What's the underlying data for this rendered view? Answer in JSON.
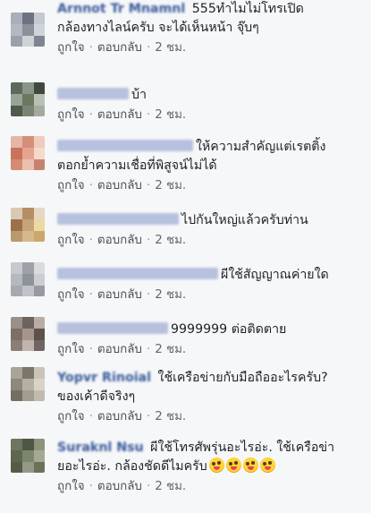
{
  "comments": [
    {
      "name": "Arnnot Tr Mnamnl",
      "lines": [
        "555ทำไมไม่โทรเปิด",
        "กล้องทางไลน์ครับ จะได้เห็นหน้า จุ๊บๆ"
      ],
      "like": "ถูกใจ",
      "reply": "ตอบกลับ",
      "time": "2 ชม.",
      "avatar": [
        "#a9aeb8",
        "#6d7280",
        "#c4c8cf",
        "#b3b8c1",
        "#8b909b",
        "#d0d3d8",
        "#9ba1ab",
        "#cfd2d7",
        "#7e8490"
      ]
    },
    {
      "name": "",
      "lines": [
        "บ้า"
      ],
      "like": "ถูกใจ",
      "reply": "ตอบกลับ",
      "time": "2 ชม.",
      "avatar": [
        "#5b6a5a",
        "#8a9488",
        "#3f4a3e",
        "#9aa398",
        "#6c775f",
        "#b8bfb4",
        "#4d5a4c",
        "#7a8374",
        "#a3ab9f"
      ]
    },
    {
      "name": "",
      "lines": [
        "ให้ความสำคัญแต่เรตติ้ง",
        "ตอกย้ำความเชื่อที่พิสูจน์ไม่ได้"
      ],
      "like": "ถูกใจ",
      "reply": "ตอบกลับ",
      "time": "2 ชม.",
      "avatar": [
        "#e3b7a4",
        "#d38f79",
        "#f0cbbb",
        "#c9735d",
        "#e6a48f",
        "#f4d9cd",
        "#d68a74",
        "#ecc0ae",
        "#c7826d"
      ]
    },
    {
      "name": "",
      "lines": [
        "ไปกันใหญ่แล้วครับท่าน"
      ],
      "like": "ถูกใจ",
      "reply": "ตอบกลับ",
      "time": "2 ชม.",
      "avatar": [
        "#d9c9b3",
        "#b38e66",
        "#e6d8c3",
        "#9c7048",
        "#c7a37a",
        "#edd9a2",
        "#b89a6e",
        "#d6b98a",
        "#caa86a"
      ]
    },
    {
      "name": "",
      "lines": [
        "ผีใช้สัญญาณค่ายใด"
      ],
      "like": "ถูกใจ",
      "reply": "ตอบกลับ",
      "time": "2 ชม.",
      "avatar": [
        "#c7c9cc",
        "#9ea2a8",
        "#d9dbde",
        "#b5b8bd",
        "#8e9299",
        "#cbcdd1",
        "#a6a9af",
        "#c0c3c7",
        "#979ba1"
      ]
    },
    {
      "name": "",
      "lines": [
        "9999999 ต่อติดตาย"
      ],
      "like": "ถูกใจ",
      "reply": "ตอบกลับ",
      "time": "2 ชม.",
      "avatar": [
        "#9a8f89",
        "#6f625c",
        "#b8aca4",
        "#7d6f68",
        "#a6958c",
        "#5d514c",
        "#8c7d76",
        "#c2b4ab",
        "#706560"
      ]
    },
    {
      "name": "Yopvr Rinoial",
      "lines": [
        "ใช้เครือข่ายกับมือถืออะไรครับ?",
        "ของเค้าดีจริงๆ"
      ],
      "like": "ถูกใจ",
      "reply": "ตอบกลับ",
      "time": "2 ชม.",
      "avatar": [
        "#a9a39a",
        "#7c756a",
        "#c9c3b8",
        "#8f887c",
        "#b6afa3",
        "#d8d2c7",
        "#746d62",
        "#a39c90",
        "#c1bbaf"
      ]
    },
    {
      "name": "Suraknl Nsu",
      "lines": [
        "ผีใช้โทรศัพรุ่นอะไรอ่ะ. ใช้เครือข่า",
        "ยอะไรอ่ะ. กล้องชัดดีไมครับ"
      ],
      "emoji_count": 4,
      "like": "ถูกใจ",
      "reply": "ตอบกลับ",
      "time": "2 ชม.",
      "avatar": [
        "#6e7560",
        "#4e5744",
        "#8c937c",
        "#5c6650",
        "#7d856d",
        "#a3a993",
        "#545c48",
        "#939a84",
        "#6a7259"
      ]
    }
  ]
}
